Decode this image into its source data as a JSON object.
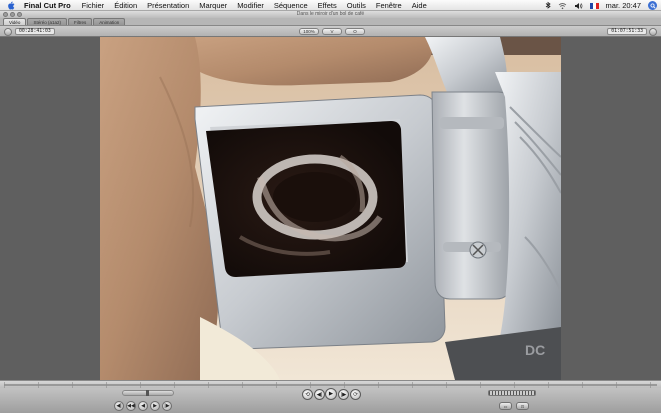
{
  "menubar": {
    "app_name": "Final Cut Pro",
    "items": [
      "Fichier",
      "Édition",
      "Présentation",
      "Marquer",
      "Modifier",
      "Séquence",
      "Effets",
      "Outils",
      "Fenêtre",
      "Aide"
    ],
    "clock": "mar. 20:47",
    "icons": [
      "apple-icon",
      "bluetooth-icon",
      "wifi-icon",
      "volume-icon",
      "french-flag-icon",
      "spotlight-icon"
    ]
  },
  "window": {
    "title": "Dans le miroir d'un bol de café"
  },
  "tabs": [
    "Vidéo",
    "Stéréo (a1a2)",
    "Filtres",
    "Animation"
  ],
  "controls": {
    "duration_timecode": "00:28:41:03",
    "current_timecode": "01:07:51:33",
    "zoom_label": "100%",
    "view_label": "V",
    "overlay_label": "O"
  },
  "transport": {
    "left_buttons": [
      "◀|",
      "◀◀",
      "◀",
      "▶",
      "|▶"
    ],
    "center_buttons": [
      "⟲",
      "◀|",
      "▶",
      "|▶",
      "⟳"
    ],
    "right_buttons": [
      "▭",
      "⊡"
    ]
  },
  "colors": {
    "canvas_background": "#5f5f5f",
    "menubar_background": "#f0f0f0",
    "spotlight_accent": "#3b6fd3"
  }
}
